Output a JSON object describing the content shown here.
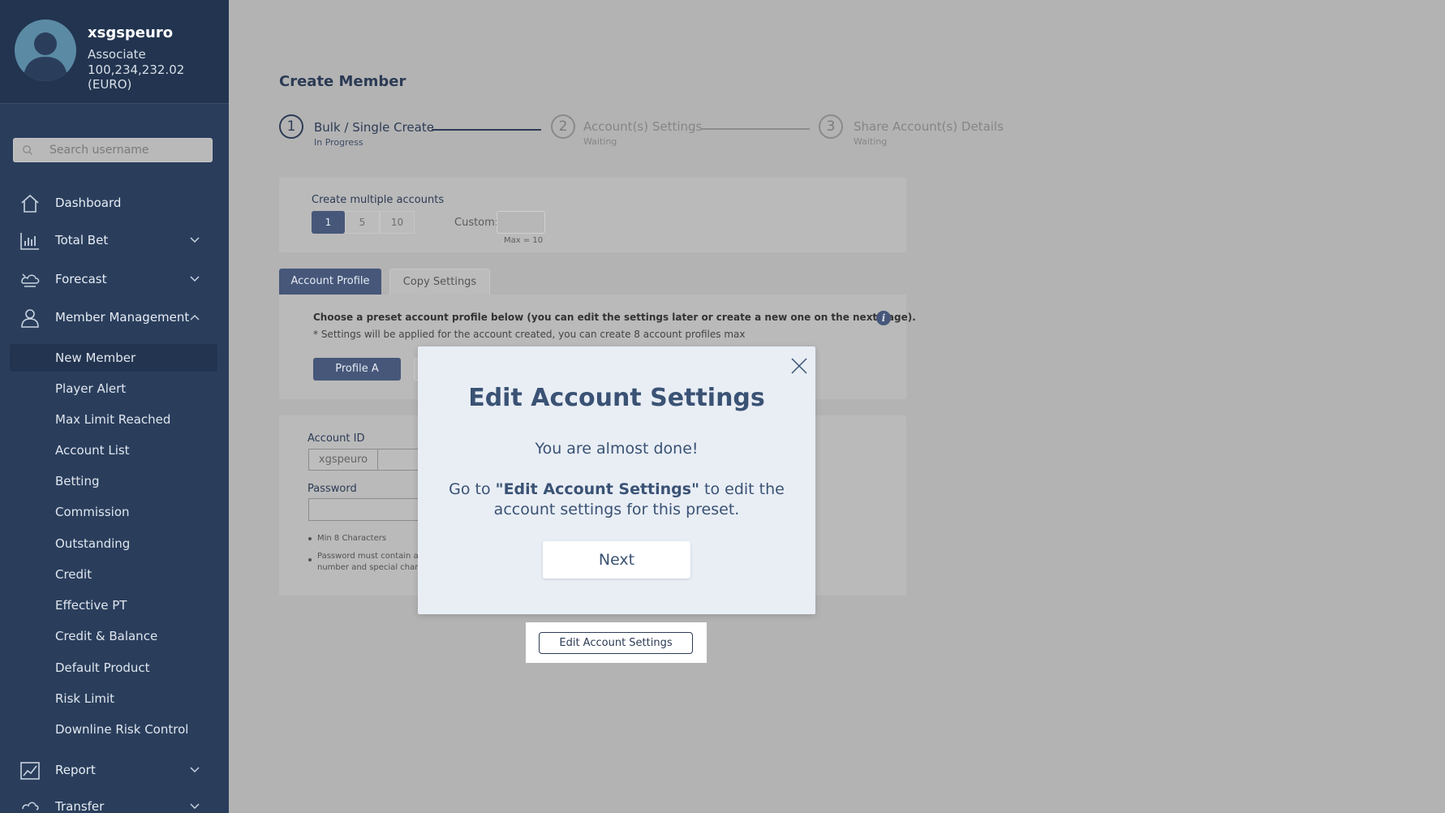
{
  "user": {
    "username": "xsgspeuro",
    "role": "Associate",
    "balance": "100,234,232.02 (EURO)"
  },
  "search": {
    "placeholder": "Search username"
  },
  "nav": {
    "dashboard": "Dashboard",
    "total_bet": "Total Bet",
    "forecast": "Forecast",
    "member_management": "Member Management",
    "report": "Report",
    "transfer": "Transfer"
  },
  "member_menu": [
    "New Member",
    "Player Alert",
    "Max Limit Reached",
    "Account List",
    "Betting",
    "Commission",
    "Outstanding",
    "Credit",
    "Effective PT",
    "Credit & Balance",
    "Default Product",
    "Risk Limit",
    "Downline Risk Control"
  ],
  "page": {
    "title": "Create Member"
  },
  "steps": [
    {
      "num": "1",
      "title": "Bulk / Single Create",
      "status": "In Progress"
    },
    {
      "num": "2",
      "title": "Account(s) Settings",
      "status": "Waiting"
    },
    {
      "num": "3",
      "title": "Share Account(s) Details",
      "status": "Waiting"
    }
  ],
  "bulk": {
    "label": "Create multiple accounts",
    "options": [
      "1",
      "5",
      "10"
    ],
    "selected": "1",
    "custom_label": "Custom:",
    "max_hint": "Max = 10"
  },
  "tabs": {
    "account_profile": "Account Profile",
    "copy_settings": "Copy Settings"
  },
  "profile_section": {
    "description": "Choose a preset account profile below (you can edit the settings later or create a new one on the next page).",
    "note": "* Settings will be applied for the account created, you can create 8 account profiles max",
    "profile_a": "Profile A",
    "info_icon": "i"
  },
  "account_form": {
    "account_id_label": "Account ID",
    "account_id_prefix": "xgspeuro",
    "password_label": "Password",
    "hint1": "Min 8 Characters",
    "hint2_line1": "Password must contain a co",
    "hint2_line2": "number and special charact"
  },
  "edit_button": "Edit Account Settings",
  "modal": {
    "title": "Edit Account Settings",
    "line1": "You are almost done!",
    "line2_pre": "Go to ",
    "line2_bold": "\"Edit Account Settings\"",
    "line2_post": " to edit the",
    "line3": "account settings for this preset.",
    "next": "Next"
  },
  "colors": {
    "sidebar": "#2a3e5c",
    "sidebar_header": "#22344f",
    "overlay_bg": "#b3b3b3",
    "accent": "#46577a",
    "modal_bg": "#e9eef5",
    "modal_text": "#3a5274"
  }
}
